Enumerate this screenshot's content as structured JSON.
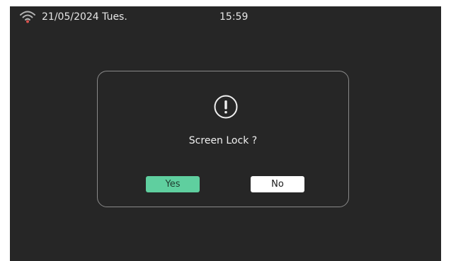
{
  "status_bar": {
    "wifi_icon": "wifi-icon",
    "wifi_color": "#d9534f",
    "date": "21/05/2024 Tues.",
    "time": "15:59"
  },
  "dialog": {
    "icon": "alert-icon",
    "message": "Screen Lock ?",
    "yes_label": "Yes",
    "no_label": "No",
    "yes_color": "#5fcf9f",
    "no_color": "#ffffff"
  }
}
